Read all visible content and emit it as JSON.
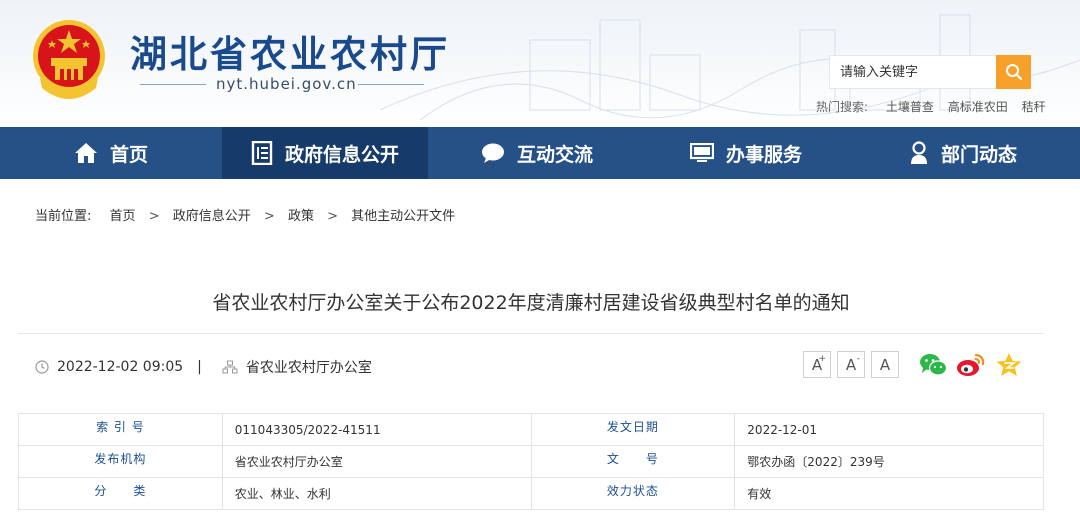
{
  "site": {
    "title": "湖北省农业农村厅",
    "domain": "nyt.hubei.gov.cn"
  },
  "search": {
    "placeholder": "请输入关键字",
    "hot_label": "热门搜索:",
    "hot_terms": [
      "土壤普查",
      "高标准农田",
      "秸秆"
    ]
  },
  "nav": [
    {
      "label": "首页",
      "icon": "home-icon"
    },
    {
      "label": "政府信息公开",
      "icon": "document-icon"
    },
    {
      "label": "互动交流",
      "icon": "chat-bubble-icon"
    },
    {
      "label": "办事服务",
      "icon": "monitor-icon"
    },
    {
      "label": "部门动态",
      "icon": "person-icon"
    }
  ],
  "nav_active": "政府信息公开",
  "breadcrumb": {
    "prefix": "当前位置:",
    "items": [
      "首页",
      "政府信息公开",
      "政策",
      "其他主动公开文件"
    ],
    "separator": ">"
  },
  "article": {
    "title": "省农业农村厅办公室关于公布2022年度清廉村居建设省级典型村名单的通知",
    "datetime": "2022-12-02 09:05",
    "divider": "|",
    "source": "省农业农村厅办公室"
  },
  "font_controls": [
    "A+",
    "A-",
    "A"
  ],
  "share_icons": [
    "wechat-icon",
    "weibo-icon",
    "qzone-icon"
  ],
  "info_table": {
    "rows": [
      {
        "k1": "索 引 号",
        "v1": "011043305/2022-41511",
        "k2": "发文日期",
        "v2": "2022-12-01"
      },
      {
        "k1": "发布机构",
        "v1": "省农业农村厅办公室",
        "k2": "文　　号",
        "v2": "鄂农办函〔2022〕239号"
      },
      {
        "k1": "分　　类",
        "v1": "农业、林业、水利",
        "k2": "效力状态",
        "v2": "有效"
      }
    ]
  },
  "colors": {
    "brand_blue": "#255187",
    "nav_active": "#163b6a",
    "title_blue": "#1a4a8c",
    "search_orange": "#f7a12a",
    "emblem_red": "#d7141a",
    "emblem_gold": "#f4c430"
  }
}
